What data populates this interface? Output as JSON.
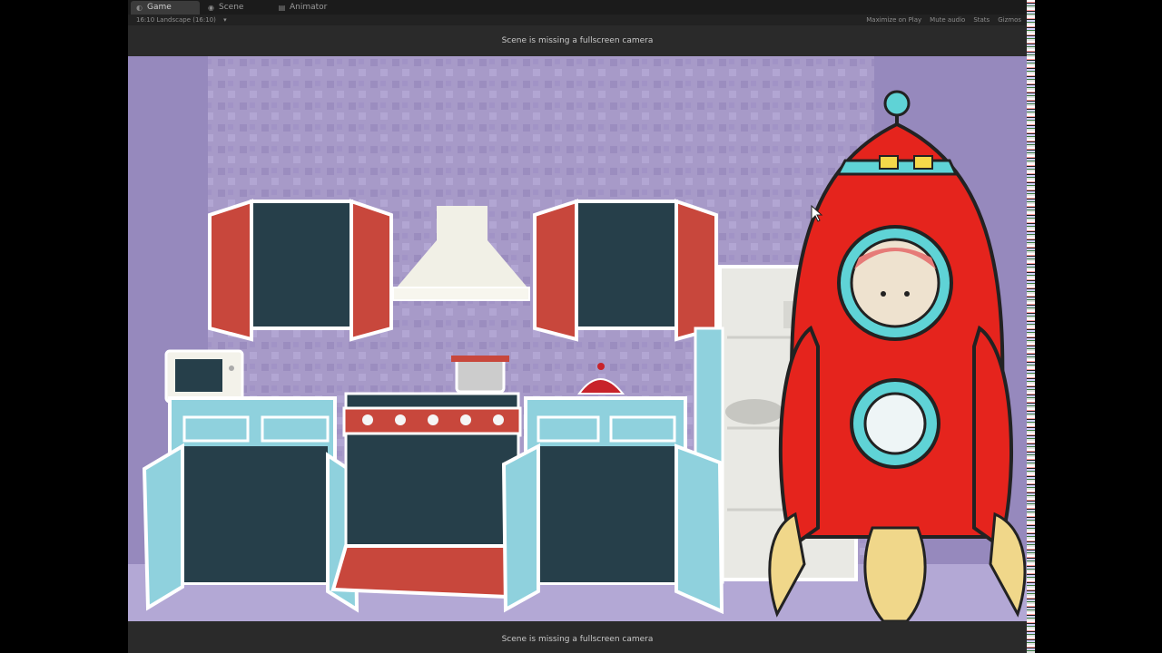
{
  "tabs": [
    {
      "label": "Game",
      "icon": "game-icon"
    },
    {
      "label": "Scene",
      "icon": "scene-icon"
    },
    {
      "label": "Animator",
      "icon": "animator-icon"
    }
  ],
  "toolbar": {
    "aspect": "16:10 Landscape (16:10)",
    "maximize": "Maximize on Play",
    "mute": "Mute audio",
    "stats": "Stats",
    "gizmos": "Gizmos"
  },
  "messages": {
    "top": "Scene is missing a fullscreen camera",
    "bottom": "Scene is missing a fullscreen camera"
  },
  "colors": {
    "wall": "#a79ac8",
    "floor": "#b3a8d5",
    "cabinet_red": "#c8473c",
    "cabinet_blue": "#8fd1dd",
    "dark_panel": "#263f4a",
    "rocket_red": "#e5241d",
    "rocket_teal": "#5fd3d6"
  }
}
